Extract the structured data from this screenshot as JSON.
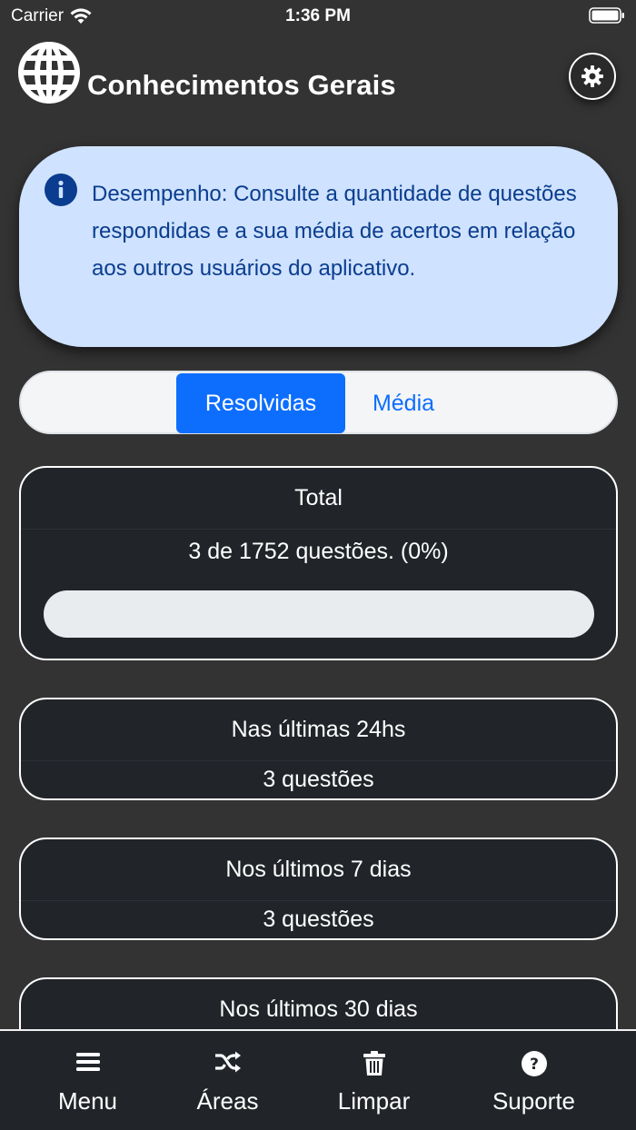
{
  "status_bar": {
    "carrier": "Carrier",
    "time": "1:36 PM"
  },
  "header": {
    "title": "Conhecimentos Gerais",
    "logo_icon": "globe-icon",
    "settings_icon": "gear-icon"
  },
  "info": {
    "icon": "info-icon",
    "text": "Desempenho: Consulte a quantidade de questões respondidas e a sua média de acertos em relação aos outros usuários do aplicativo."
  },
  "segment": {
    "options": [
      "Resolvidas",
      "Média"
    ],
    "selected": "Resolvidas"
  },
  "cards": [
    {
      "title": "Total",
      "value": "3 de 1752 questões. (0%)",
      "progress": 0
    },
    {
      "title": "Nas últimas 24hs",
      "value": "3 questões"
    },
    {
      "title": "Nos últimos 7 dias",
      "value": "3 questões"
    },
    {
      "title": "Nos últimos 30 dias"
    }
  ],
  "tabbar": {
    "tabs": [
      {
        "label": "Menu",
        "icon": "menu-icon"
      },
      {
        "label": "Áreas",
        "icon": "shuffle-icon"
      },
      {
        "label": "Limpar",
        "icon": "trash-icon"
      },
      {
        "label": "Suporte",
        "icon": "help-icon"
      }
    ]
  },
  "colors": {
    "background": "#333333",
    "card": "#212529",
    "accent": "#0d6efd",
    "info_bg": "#cfe2ff",
    "info_text": "#0a3d8f"
  }
}
